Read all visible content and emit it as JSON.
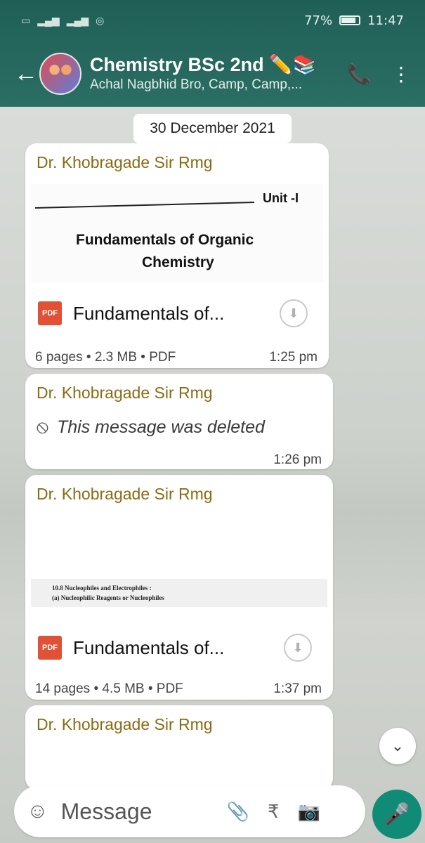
{
  "status_bar": {
    "battery": "77%",
    "time": "11:47"
  },
  "header": {
    "title": "Chemistry BSc 2nd",
    "title_emoji": "✏️📚",
    "subtitle": "Achal Nagbhid Bro, Camp, Camp,..."
  },
  "date_chip": "30 December 2021",
  "messages": [
    {
      "sender": "Dr. Khobragade Sir Rmg",
      "preview_lines": [
        "Unit -I",
        "Fundamentals of Organic",
        "Chemistry"
      ],
      "doc_type_label": "PDF",
      "doc_name": "Fundamentals of...",
      "meta": "6 pages • 2.3 MB • PDF",
      "time": "1:25 pm"
    },
    {
      "sender": "Dr. Khobragade Sir Rmg",
      "deleted_text": "This message was deleted",
      "time": "1:26 pm"
    },
    {
      "sender": "Dr. Khobragade Sir Rmg",
      "preview_lines": [
        "10.8 Nucleophiles and Electrophiles :",
        "(a) Nucleophilic Reagents or Nucleophiles"
      ],
      "doc_type_label": "PDF",
      "doc_name": "Fundamentals of...",
      "meta": "14 pages • 4.5 MB • PDF",
      "time": "1:37 pm"
    },
    {
      "sender": "Dr. Khobragade Sir Rmg"
    }
  ],
  "composer": {
    "placeholder": "Message"
  },
  "colors": {
    "header_bg": "#2b6e64",
    "sender": "#8a6a12",
    "pdf_badge": "#e05136",
    "mic_button": "#0f8b76"
  }
}
